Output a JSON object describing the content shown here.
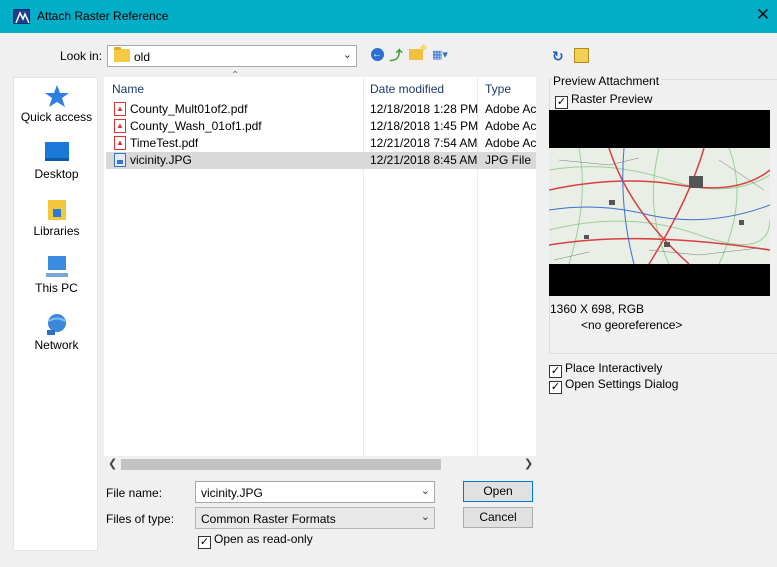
{
  "window": {
    "title": "Attach Raster Reference",
    "close_glyph": "✕"
  },
  "lookin": {
    "label": "Look in:",
    "value": "old"
  },
  "places": [
    {
      "label": "Quick access",
      "icon": "star-icon"
    },
    {
      "label": "Desktop",
      "icon": "desktop-icon"
    },
    {
      "label": "Libraries",
      "icon": "libraries-icon"
    },
    {
      "label": "This PC",
      "icon": "computer-icon"
    },
    {
      "label": "Network",
      "icon": "network-icon"
    }
  ],
  "columns": {
    "name": "Name",
    "date": "Date modified",
    "type": "Type"
  },
  "files": [
    {
      "name": "County_Mult01of2.pdf",
      "date": "12/18/2018 1:28 PM",
      "type": "Adobe Ac",
      "icon": "pdf-icon",
      "selected": false
    },
    {
      "name": "County_Wash_01of1.pdf",
      "date": "12/18/2018 1:45 PM",
      "type": "Adobe Ac",
      "icon": "pdf-icon",
      "selected": false
    },
    {
      "name": "TimeTest.pdf",
      "date": "12/21/2018 7:54 AM",
      "type": "Adobe Ac",
      "icon": "pdf-icon",
      "selected": false
    },
    {
      "name": "vicinity.JPG",
      "date": "12/21/2018 8:45 AM",
      "type": "JPG File",
      "icon": "jpg-icon",
      "selected": true
    }
  ],
  "filename": {
    "label": "File name:",
    "value": "vicinity.JPG"
  },
  "filetype": {
    "label": "Files of type:",
    "value": "Common Raster Formats"
  },
  "buttons": {
    "open": "Open",
    "cancel": "Cancel"
  },
  "open_readonly": {
    "label": "Open as read-only",
    "checked": true
  },
  "preview": {
    "title": "Preview Attachment",
    "raster_preview_label": "Raster Preview",
    "raster_preview_checked": true,
    "dimensions": "1360 X 698, RGB",
    "georef": "<no georeference>"
  },
  "place_interactively": {
    "label": "Place Interactively",
    "checked": true
  },
  "open_settings": {
    "label": "Open Settings Dialog",
    "checked": true
  },
  "colors": {
    "titlebar": "#00aec7",
    "selected_row": "#d9d9d9",
    "dialog_bg": "#f0f0f0"
  }
}
